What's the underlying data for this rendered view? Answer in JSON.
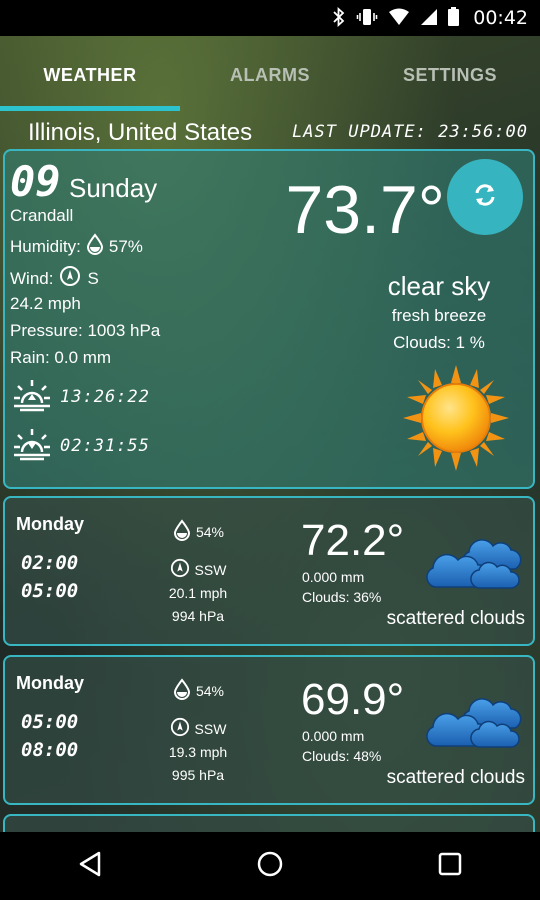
{
  "status_bar": {
    "time": "00:42",
    "icons": [
      "bluetooth-icon",
      "vibrate-icon",
      "wifi-icon",
      "signal-icon",
      "battery-icon"
    ]
  },
  "tabs": [
    {
      "label": "WEATHER",
      "active": true
    },
    {
      "label": "ALARMS",
      "active": false
    },
    {
      "label": "SETTINGS",
      "active": false
    }
  ],
  "location": "Illinois, United States",
  "last_update": "LAST UPDATE: 23:56:00",
  "current": {
    "day_number": "09",
    "day_name": "Sunday",
    "city": "Crandall",
    "humidity_label": "Humidity:",
    "humidity_value": "57%",
    "wind_label": "Wind:",
    "wind_dir": "S",
    "wind_speed": "24.2 mph",
    "pressure": "Pressure: 1003 hPa",
    "rain": "Rain: 0.0 mm",
    "sunrise": "13:26:22",
    "sunset": "02:31:55",
    "temperature": "73.7°",
    "condition": "clear sky",
    "wind_desc": "fresh breeze",
    "clouds": "Clouds: 1 %",
    "weather_icon": "sun-icon"
  },
  "forecast": [
    {
      "day": "Monday",
      "time_from": "02:00",
      "time_to": "05:00",
      "humidity": "54%",
      "wind_dir": "SSW",
      "wind_speed": "20.1 mph",
      "pressure": "994 hPa",
      "temperature": "72.2°",
      "rain": "0.000 mm",
      "clouds": "Clouds: 36%",
      "condition": "scattered clouds",
      "weather_icon": "clouds-icon"
    },
    {
      "day": "Monday",
      "time_from": "05:00",
      "time_to": "08:00",
      "humidity": "54%",
      "wind_dir": "SSW",
      "wind_speed": "19.3 mph",
      "pressure": "995 hPa",
      "temperature": "69.9°",
      "rain": "0.000 mm",
      "clouds": "Clouds: 48%",
      "condition": "scattered clouds",
      "weather_icon": "clouds-icon"
    }
  ],
  "colors": {
    "accent": "#2cc3cf",
    "card_border": "#38b6c2",
    "sun": "#f7a21b"
  }
}
